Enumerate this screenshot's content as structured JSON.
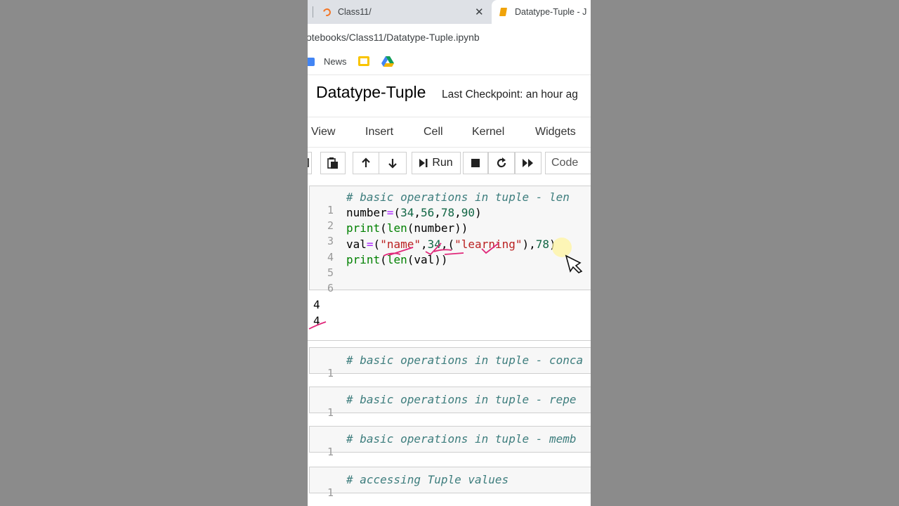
{
  "tabs": [
    {
      "label": "Class11/",
      "icon": "jupyter-icon",
      "active": false
    },
    {
      "label": "Datatype-Tuple - J",
      "icon": "notebook-icon",
      "active": true
    }
  ],
  "url": "otebooks/Class11/Datatype-Tuple.ipynb",
  "bookmarks": [
    {
      "label": "News",
      "icon": "google-news-icon"
    },
    {
      "label": "",
      "icon": "google-slides-icon"
    },
    {
      "label": "",
      "icon": "google-drive-icon"
    }
  ],
  "notebook": {
    "title": "Datatype-Tuple",
    "checkpoint": "Last Checkpoint: an hour ag"
  },
  "menu": [
    "View",
    "Insert",
    "Cell",
    "Kernel",
    "Widgets"
  ],
  "toolbar": {
    "run_label": "Run",
    "cell_type": "Code",
    "icons": [
      "copy-icon",
      "paste-icon",
      "arrow-up-icon",
      "arrow-down-icon",
      "run-icon",
      "stop-icon",
      "restart-icon",
      "fast-forward-icon"
    ]
  },
  "cell1": {
    "line_numbers": [
      "1",
      "2",
      "3",
      "4",
      "5",
      "6"
    ],
    "lines": {
      "l1": "# basic operations in tuple - len",
      "l2": {
        "a": "number",
        "eq": "=",
        "b": "(",
        "n1": "34",
        "c1": ",",
        "n2": "56",
        "c2": ",",
        "n3": "78",
        "c3": ",",
        "n4": "90",
        "e": ")"
      },
      "l3": {
        "fn": "print",
        "a": "(",
        "fn2": "len",
        "b": "(number))"
      },
      "l4": {
        "a": "val",
        "eq": "=",
        "b": "(",
        "s1": "\"name\"",
        "c1": ",",
        "n1": "34",
        "c2": ",(",
        "s2": "\"learning\"",
        "c3": "),",
        "n2": "78",
        "e": ")"
      },
      "l5": {
        "fn": "print",
        "a": "(",
        "fn2": "len",
        "b": "(val))"
      }
    },
    "outputs": [
      "4",
      "4"
    ]
  },
  "collapsed_cells": [
    {
      "num": "1",
      "text": "# basic operations in tuple - conca"
    },
    {
      "num": "1",
      "text": "# basic operations in tuple - repe"
    },
    {
      "num": "1",
      "text": "# basic operations in tuple - memb"
    },
    {
      "num": "1",
      "text": "# accessing Tuple values"
    }
  ]
}
